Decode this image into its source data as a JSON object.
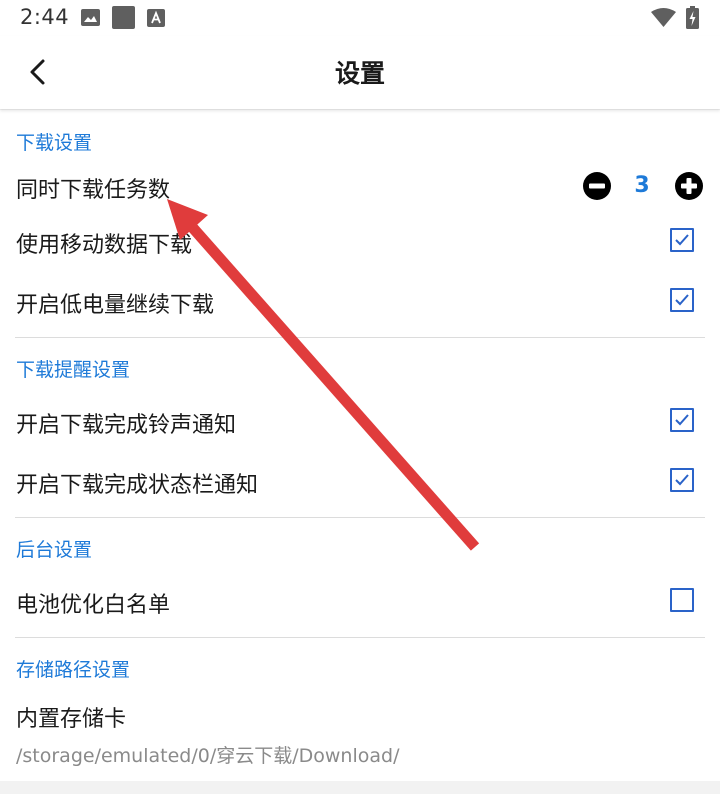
{
  "status_bar": {
    "time": "2:44",
    "left_icons": [
      "image-icon",
      "square-app-icon",
      "font-icon"
    ],
    "right_icons": [
      "wifi-icon",
      "battery-charging-icon"
    ]
  },
  "app_bar": {
    "title": "设置",
    "back_icon": "chevron-left-icon"
  },
  "sections": {
    "download": {
      "header": "下载设置",
      "concurrent": {
        "label": "同时下载任务数",
        "value": "3",
        "decrement_icon": "minus-circle-icon",
        "increment_icon": "plus-circle-icon"
      },
      "mobile_data": {
        "label": "使用移动数据下载",
        "checked": true
      },
      "low_battery": {
        "label": "开启低电量继续下载",
        "checked": true
      }
    },
    "reminder": {
      "header": "下载提醒设置",
      "ringtone": {
        "label": "开启下载完成铃声通知",
        "checked": true
      },
      "statusbar": {
        "label": "开启下载完成状态栏通知",
        "checked": true
      }
    },
    "background": {
      "header": "后台设置",
      "battery_whitelist": {
        "label": "电池优化白名单",
        "checked": false
      }
    },
    "storage": {
      "header": "存储路径设置",
      "internal": {
        "label": "内置存储卡",
        "path": "/storage/emulated/0/穿云下载/Download/"
      }
    }
  },
  "colors": {
    "accent": "#1e7ad8",
    "checkbox": "#2a63c9",
    "annotation_arrow": "#e03c3c",
    "divider": "#dcdcdc"
  },
  "annotation": {
    "type": "arrow",
    "color": "#e03c3c"
  }
}
